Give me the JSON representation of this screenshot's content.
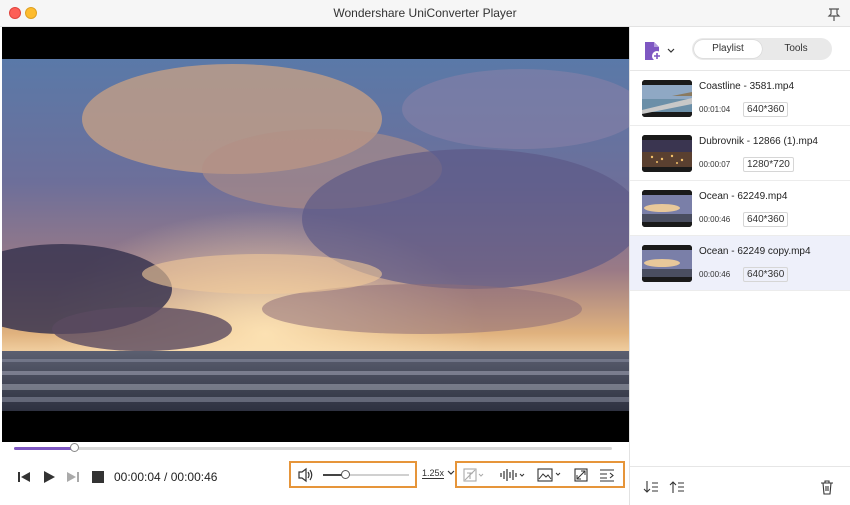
{
  "window": {
    "title": "Wondershare UniConverter Player"
  },
  "player": {
    "current_time": "00:00:04",
    "separator": " / ",
    "total_time": "00:00:46",
    "progress": 0.1,
    "volume": 0.25,
    "speed_label": "1.25x"
  },
  "sidebar": {
    "tabs": [
      {
        "label": "Playlist"
      },
      {
        "label": "Tools"
      }
    ],
    "active_tab": "Playlist",
    "items": [
      {
        "name": "Coastline - 3581.mp4",
        "duration": "00:01:04",
        "resolution": "640*360",
        "active": false
      },
      {
        "name": "Dubrovnik - 12866 (1).mp4",
        "duration": "00:00:07",
        "resolution": "1280*720",
        "active": false
      },
      {
        "name": "Ocean - 62249.mp4",
        "duration": "00:00:46",
        "resolution": "640*360",
        "active": false
      },
      {
        "name": "Ocean - 62249 copy.mp4",
        "duration": "00:00:46",
        "resolution": "640*360",
        "active": true
      }
    ]
  },
  "icons": {
    "add_file": "add-file-icon",
    "pin": "pin-icon",
    "prev": "skip-back-icon",
    "play": "play-icon",
    "next": "skip-forward-icon",
    "stop": "stop-icon",
    "volume": "speaker-icon",
    "subtitle": "subtitle-icon",
    "audio_track": "audio-waveform-icon",
    "screenshot": "image-icon",
    "fullscreen": "fullscreen-icon",
    "menu": "list-icon",
    "sort_down": "sort-down-icon",
    "sort_up": "sort-up-icon",
    "delete": "trash-icon"
  },
  "colors": {
    "accent": "#7e57c2",
    "highlight_box": "#e6953a",
    "active_item": "#eef0fa"
  }
}
